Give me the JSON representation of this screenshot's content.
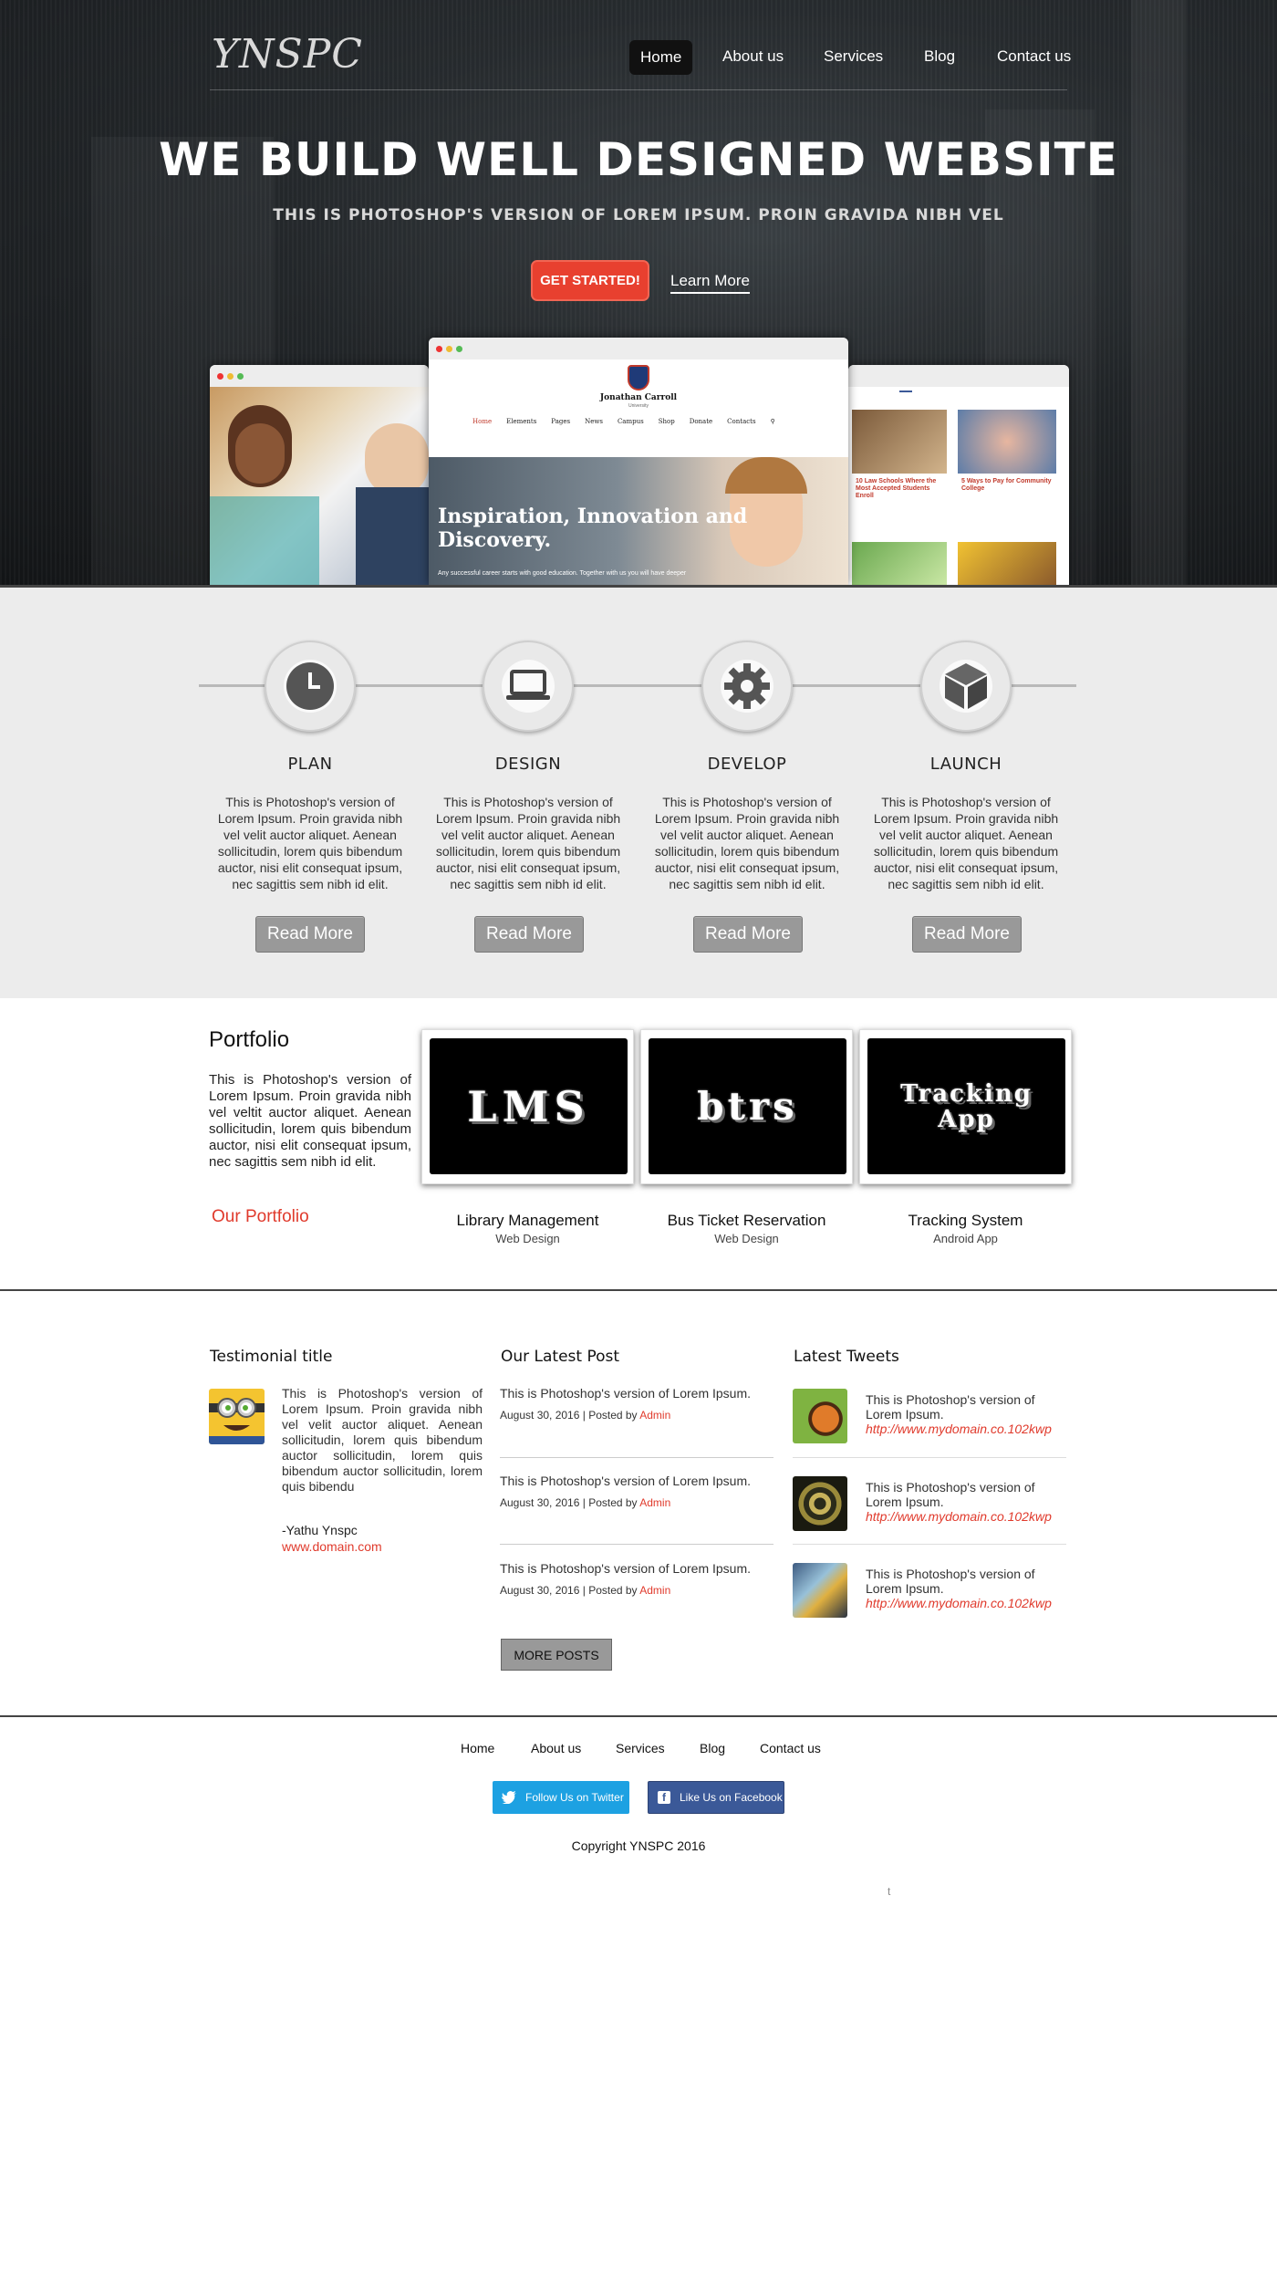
{
  "header": {
    "logo": "YNSPC",
    "nav": [
      "Home",
      "About us",
      "Services",
      "Blog",
      "Contact us"
    ],
    "active": "Home"
  },
  "hero": {
    "title": "We Build Well Designed Website",
    "subtitle": "This is Photoshop's version  of Lorem Ipsum. Proin gravida nibh vel",
    "cta": "Get Started!",
    "learn": "Learn More",
    "mockup": {
      "site_name": "Jonathan Carroll",
      "site_tag": "University",
      "menu": [
        "Home",
        "Elements",
        "Pages",
        "News",
        "Campus",
        "Shop",
        "Donate",
        "Contacts"
      ],
      "banner": "Inspiration, Innovation and Discovery.",
      "banner_sub": "Any successful career starts with good education. Together with us you will have deeper",
      "right_card1": "10 Law Schools Where the Most Accepted Students Enroll",
      "right_card2": "5 Ways to Pay for Community College"
    }
  },
  "process": {
    "steps": [
      {
        "title": "PLAN",
        "icon": "clock-icon",
        "desc": "This is Photoshop's version  of Lorem Ipsum. Proin gravida nibh vel velit auctor aliquet. Aenean sollicitudin, lorem quis bibendum auctor, nisi elit consequat ipsum, nec sagittis sem nibh id elit.",
        "button": "Read More"
      },
      {
        "title": "DESIGN",
        "icon": "laptop-icon",
        "desc": "This is Photoshop's version  of Lorem Ipsum. Proin gravida nibh vel velit auctor aliquet. Aenean sollicitudin, lorem quis bibendum auctor, nisi elit consequat ipsum, nec sagittis sem nibh id elit.",
        "button": "Read More"
      },
      {
        "title": "DEVELOP",
        "icon": "gear-icon",
        "desc": "This is Photoshop's version  of Lorem Ipsum. Proin gravida nibh vel velit auctor aliquet. Aenean sollicitudin, lorem quis bibendum auctor, nisi elit consequat ipsum, nec sagittis sem nibh id elit.",
        "button": "Read More"
      },
      {
        "title": "LAUNCH",
        "icon": "cube-icon",
        "desc": "This is Photoshop's version  of Lorem Ipsum. Proin gravida nibh vel velit auctor aliquet. Aenean sollicitudin, lorem quis bibendum auctor, nisi elit consequat ipsum, nec sagittis sem nibh id elit.",
        "button": "Read More"
      }
    ]
  },
  "portfolio": {
    "title": "Portfolio",
    "desc": "This is Photoshop's version  of Lorem Ipsum. Proin gravida nibh vel veltit auctor aliquet. Aenean sollicitudin, lorem quis bibendum auctor, nisi elit consequat ipsum, nec sagittis sem nibh id elit.",
    "link": "Our Portfolio",
    "items": [
      {
        "image_text": "LMS",
        "name": "Library Management",
        "type": "Web Design"
      },
      {
        "image_text": "btrs",
        "name": "Bus Ticket Reservation",
        "type": "Web Design"
      },
      {
        "image_text": "Tracking App",
        "name": "Tracking System",
        "type": "Android App"
      }
    ]
  },
  "testimonial": {
    "title": "Testimonial title",
    "text": "This is Photoshop's version  of Lorem Ipsum. Proin gravida nibh vel velit auctor aliquet. Aenean sollicitudin, lorem quis bibendum auctor sollicitudin, lorem quis bibendum auctor sollicitudin, lorem quis bibendu",
    "author": "-Yathu Ynspc",
    "link": "www.domain.com"
  },
  "posts": {
    "title": "Our Latest Post",
    "items": [
      {
        "text": "This is Photoshop's version  of Lorem Ipsum.",
        "meta": "August 30, 2016 | Posted by ",
        "by": "Admin"
      },
      {
        "text": "This is Photoshop's version  of Lorem Ipsum.",
        "meta": "August 30, 2016 | Posted by ",
        "by": "Admin"
      },
      {
        "text": "This is Photoshop's version  of Lorem Ipsum.",
        "meta": "August 30, 2016 | Posted by ",
        "by": "Admin"
      }
    ],
    "button": "MORE POSTS"
  },
  "tweets": {
    "title": "Latest Tweets",
    "items": [
      {
        "text": "This is Photoshop's version  of Lorem Ipsum.",
        "link": "http://www.mydomain.co.102kwp"
      },
      {
        "text": "This is Photoshop's version  of Lorem Ipsum.",
        "link": "http://www.mydomain.co.102kwp"
      },
      {
        "text": "This is Photoshop's version  of Lorem Ipsum.",
        "link": "http://www.mydomain.co.102kwp"
      }
    ]
  },
  "footer": {
    "nav": [
      "Home",
      "About us",
      "Services",
      "Blog",
      "Contact us"
    ],
    "twitter": "Follow Us on Twitter",
    "facebook": "Like Us on Facebook",
    "copyright": "Copyright YNSPC 2016",
    "stray": "t"
  },
  "colors": {
    "accent": "#e8402f",
    "twitter": "#1da1e2",
    "facebook": "#3b5998",
    "button_gray": "#999999"
  }
}
